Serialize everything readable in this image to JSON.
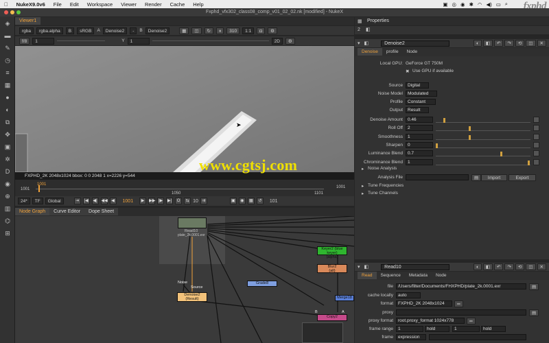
{
  "menubar": {
    "app": "NukeX9.0v6",
    "items": [
      "File",
      "Edit",
      "Workspace",
      "Viewer",
      "Render",
      "Cache",
      "Help"
    ],
    "brand": "fxphd"
  },
  "window": {
    "title": "Fxphd_vfx302_class08_comp_v01_02_02.nk [modified] - NukeX"
  },
  "viewer": {
    "tab": "Viewer1",
    "channels": "rgba",
    "alpha": "rgba.alpha",
    "channel_b": "B",
    "colorspace": "sRGB",
    "input_a_label": "A",
    "input_a": "Denoise2",
    "dash": "-",
    "input_b_label": "B",
    "input_b": "Denoise2",
    "zoom": "310",
    "scale": "1:1",
    "fstop": "f/8",
    "gain": "1",
    "y_label": "Y",
    "gamma": "1",
    "view": "2D",
    "info": "FXPHD_2K 2048x1024   bbox: 0 0 2048 1   x=2226 y=544",
    "watermark": "www.cgtsj.com",
    "timeline": {
      "start": "1001",
      "mid": "1050",
      "end": "1101",
      "current": "1001"
    },
    "fps": "24*",
    "tf": "TF",
    "global": "Global",
    "frame": "1001",
    "increment": "10",
    "last": "101"
  },
  "nodegraph": {
    "tabs": [
      "Node Graph",
      "Curve Editor",
      "Dope Sheet"
    ],
    "nodes": {
      "read10": "Read10",
      "read10_file": "plate_2k.0001.exr",
      "noise": "Noise",
      "source": "Source",
      "denoise": "Denoise2",
      "denoise_sub": "(Result)",
      "grade": "Grade8",
      "keyer": "Keyer2 (blue keyer)",
      "keyer_sub": "(alpha)",
      "blur": "Blur2",
      "blur_sub": "(all)",
      "merge": "Merge18",
      "copy": "Copy2",
      "a": "A",
      "b": "B"
    }
  },
  "properties": {
    "title": "Properties",
    "bin_count": "2",
    "denoise": {
      "name": "Denoise2",
      "tabs": [
        "Denoise",
        "profile",
        "Node"
      ],
      "gpu_label": "Local GPU:",
      "gpu": "GeForce GT 750M",
      "use_gpu": "Use GPU if available",
      "fields": [
        {
          "label": "Source",
          "value": "Digital"
        },
        {
          "label": "Noise Model",
          "value": "Modulated"
        },
        {
          "label": "Profile",
          "value": "Constant"
        },
        {
          "label": "Output",
          "value": "Result"
        }
      ],
      "sliders": [
        {
          "label": "Denoise Amount",
          "value": "0.46",
          "pos": 0.08
        },
        {
          "label": "Roll Off",
          "value": "2",
          "pos": 0.36
        },
        {
          "label": "Smoothness",
          "value": "1",
          "pos": 0.36
        },
        {
          "label": "Sharpen",
          "value": "0",
          "pos": 0.0
        },
        {
          "label": "Luminance Blend",
          "value": "0.7",
          "pos": 0.7
        },
        {
          "label": "Chrominance Blend",
          "value": "1",
          "pos": 1.0
        }
      ],
      "noise_analysis": "Noise Analysis",
      "analysis_file": "Analysis File",
      "import": "Import",
      "export": "Export",
      "tune_freq": "Tune Frequencies",
      "tune_channels": "Tune Channels"
    },
    "read": {
      "name": "Read10",
      "tabs": [
        "Read",
        "Sequence",
        "Metadata",
        "Node"
      ],
      "file_label": "file",
      "file": "/Users/filter/Documents/FHXPHD/plate_2k.0001.exr",
      "cache_label": "cache locally",
      "cache": "auto",
      "format_label": "format",
      "format": "FXPHD_2K 2048x1024",
      "proxy_label": "proxy",
      "proxy": "",
      "proxy_format_label": "proxy format",
      "proxy_format": "root.proxy_format 1024x778",
      "frame_range_label": "frame range",
      "range_start": "1",
      "range_start_mode": "hold",
      "range_end": "1",
      "range_end_mode": "hold",
      "frame_label": "frame",
      "frame": "expression"
    }
  },
  "colors": {
    "accent": "#f2a33b",
    "denoise_node": "#f2c27a",
    "grade_node": "#7f9fe0",
    "keyer_node": "#2fb52f",
    "blur_node": "#d9895a",
    "merge_node": "#5a7fd8",
    "copy_node": "#c54a8a"
  }
}
